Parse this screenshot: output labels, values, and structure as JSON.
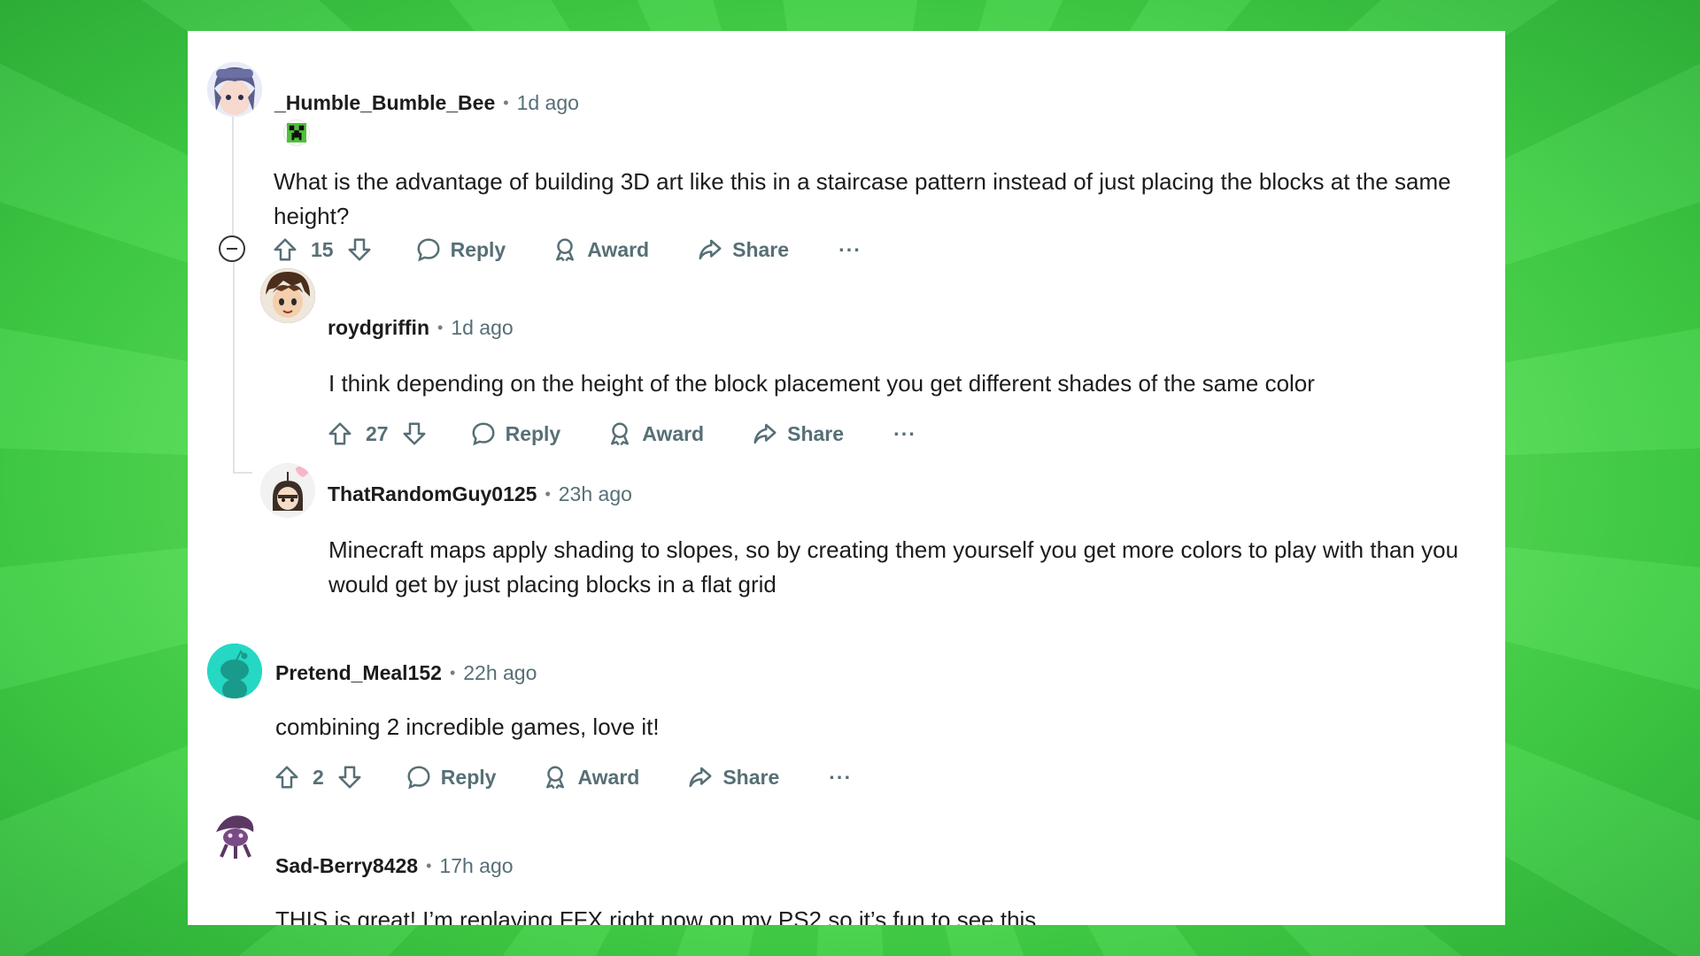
{
  "comments": [
    {
      "username": "_Humble_Bumble_Bee",
      "time": "1d ago",
      "body": "What is the advantage of building 3D art like this in a staircase pattern instead of just placing the blocks at the same height?",
      "score": "15",
      "flair_icon": "creeper-face-icon"
    },
    {
      "username": "roydgriffin",
      "time": "1d ago",
      "body": "I think depending on the height of the block placement you get different shades of the same color",
      "score": "27"
    },
    {
      "username": "ThatRandomGuy0125",
      "time": "23h ago",
      "body": "Minecraft maps apply shading to slopes, so by creating them yourself you get more colors to play with than you would get by just placing blocks in a flat grid"
    },
    {
      "username": "Pretend_Meal152",
      "time": "22h ago",
      "body": "combining 2 incredible games, love it!",
      "score": "2"
    },
    {
      "username": "Sad-Berry8428",
      "time": "17h ago",
      "body": "THIS is great! I’m replaying FFX right now on my PS2 so it’s fun to see this."
    }
  ],
  "actions": {
    "reply": "Reply",
    "award": "Award",
    "share": "Share",
    "more": "···"
  },
  "separator": "•",
  "colors": {
    "background_green": "#5fe05a",
    "card": "#ffffff",
    "text": "#1c1c1c",
    "meta": "#576f76",
    "snoo_teal": "#24d8c4"
  }
}
